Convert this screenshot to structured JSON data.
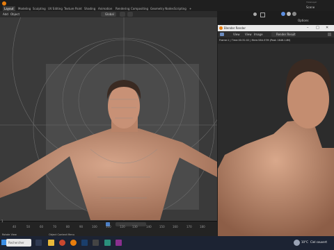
{
  "menubar": {
    "tabs": [
      "Layout",
      "Modeling",
      "Sculpting",
      "UV Editing",
      "Texture Paint",
      "Shading",
      "Animation",
      "Rendering",
      "Compositing",
      "Geometry Nodes",
      "Scripting"
    ],
    "add_tab": "+",
    "scene_label": "Scene",
    "layer_label": "ViewLayer"
  },
  "viewport_header": {
    "add": "Add",
    "object": "Object",
    "orientation": "Global",
    "options": "Options"
  },
  "timeline": {
    "ticks": [
      "40",
      "50",
      "60",
      "70",
      "80",
      "90",
      "100",
      "110",
      "120",
      "130",
      "140",
      "150",
      "160",
      "170",
      "180"
    ],
    "current_frame_prefix": "1"
  },
  "render_window": {
    "title": "Blender Render",
    "menu_view": "View",
    "menu_view2": "View",
    "menu_image": "Image",
    "render_result": "Render Result",
    "info": "Frame:1 | Time:00:32.02 | Mem:584.57M (Peak 1646.14M)"
  },
  "status_bar": {
    "rotate_view": "Rotate View",
    "context_menu": "Object Context Menu"
  },
  "taskbar": {
    "search_placeholder": "Rechercher",
    "temperature": "10°C",
    "weather": "Ciel couvert"
  }
}
